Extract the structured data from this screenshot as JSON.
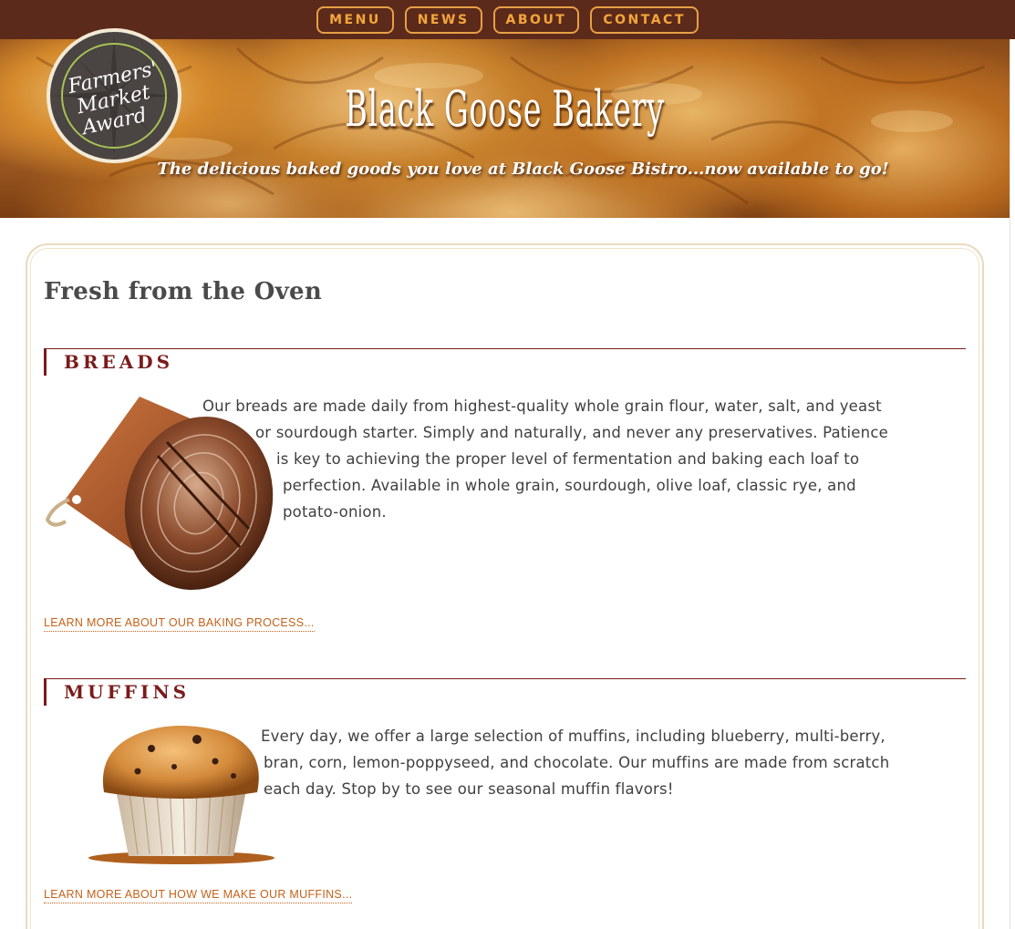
{
  "nav": {
    "items": [
      "MENU",
      "NEWS",
      "ABOUT",
      "CONTACT"
    ]
  },
  "hero": {
    "title": "Black Goose Bakery",
    "tagline": "The delicious baked goods you love at Black Goose Bistro...now available to go!",
    "award_text": [
      "Farmers'",
      "Market",
      "Award"
    ]
  },
  "main": {
    "title": "Fresh from the Oven",
    "sections": [
      {
        "heading": "BREADS",
        "text_lines": [
          "Our breads are made daily from highest-quality whole grain flour, water, salt, and yeast",
          "or sourdough starter. Simply and naturally, and never any preservatives. Patience",
          "is key to achieving the proper level of fermentation and baking each loaf to",
          "perfection. Available in whole grain, sourdough, olive loaf, classic rye, and",
          "potato-onion."
        ],
        "link": "LEARN MORE ABOUT OUR BAKING PROCESS..."
      },
      {
        "heading": "MUFFINS",
        "text_lines": [
          "Every day, we offer a large selection of muffins, including blueberry, multi-berry,",
          "bran, corn, lemon-poppyseed, and chocolate. Our muffins are made from scratch",
          "each day. Stop by to see our seasonal muffin flavors!"
        ],
        "link": "LEARN MORE ABOUT HOW WE MAKE OUR MUFFINS..."
      }
    ]
  },
  "colors": {
    "nav_bg": "#5c2a1a",
    "nav_accent": "#f4a63b",
    "heading": "#7a1b1b",
    "link": "#c4621a"
  }
}
